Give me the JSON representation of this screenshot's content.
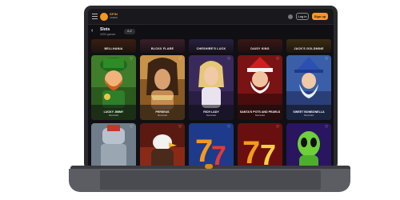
{
  "header": {
    "logo_text": "SPIN",
    "logo_sub": "CASINO",
    "login_label": "Log in",
    "signup_label": "Sign up"
  },
  "page": {
    "title": "Slots",
    "subtitle": "4000 games",
    "count_badge": "A-Z"
  },
  "top_strip": [
    {
      "label": "BELLHANIA"
    },
    {
      "label": "BLOXX FLARE"
    },
    {
      "label": "CHESHIRE'S LUCK"
    },
    {
      "label": "DAISY KING"
    },
    {
      "label": "JACK'S GOLDMINE"
    }
  ],
  "games_row1": [
    {
      "name": "LUCKY JIMMY",
      "provider": "Novomatic"
    },
    {
      "name": "PERSEUS",
      "provider": "Novomatic"
    },
    {
      "name": "RICH LADY",
      "provider": "Novomatic"
    },
    {
      "name": "SANTA'S POTS AND PEARLS",
      "provider": "Novomatic"
    },
    {
      "name": "SWEET BONBONELLA",
      "provider": "Novomatic"
    }
  ],
  "games_row2": [
    {
      "name": "",
      "provider": ""
    },
    {
      "name": "",
      "provider": ""
    },
    {
      "name": "",
      "provider": ""
    },
    {
      "name": "",
      "provider": ""
    },
    {
      "name": "",
      "provider": ""
    }
  ],
  "colors": {
    "accent": "#f39a1d",
    "background": "#101014"
  }
}
